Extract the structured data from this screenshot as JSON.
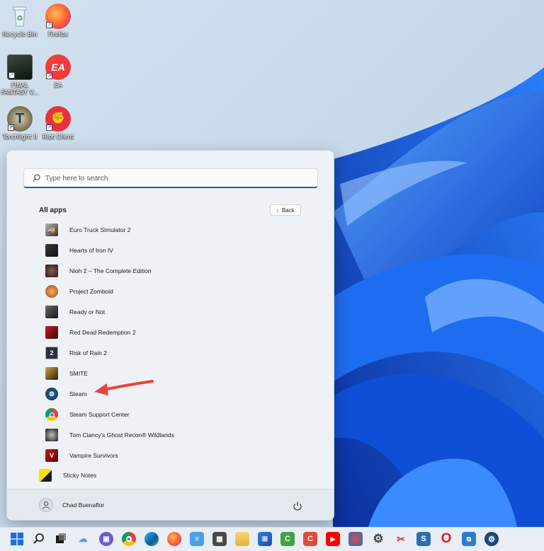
{
  "desktop": {
    "icons": [
      {
        "label": "Recycle Bin",
        "icon": "recycle-bin-icon"
      },
      {
        "label": "Firefox",
        "icon": "firefox-icon"
      },
      {
        "label": "FINAL FANTASY V...",
        "icon": "final-fantasy-icon"
      },
      {
        "label": "EA",
        "icon": "ea-icon"
      },
      {
        "label": "Torchlight II",
        "icon": "torchlight-icon"
      },
      {
        "label": "Riot Client",
        "icon": "riot-client-icon"
      }
    ]
  },
  "start_menu": {
    "search_placeholder": "Type here to search",
    "all_apps_label": "All apps",
    "back_label": "Back",
    "apps": [
      {
        "label": "Euro Truck Simulator 2",
        "icon": "euro-truck-icon"
      },
      {
        "label": "Hearts of Iron IV",
        "icon": "hearts-of-iron-icon"
      },
      {
        "label": "Nioh 2 – The Complete Edition",
        "icon": "nioh-icon"
      },
      {
        "label": "Project Zomboid",
        "icon": "project-zomboid-icon"
      },
      {
        "label": "Ready or Not",
        "icon": "ready-or-not-icon"
      },
      {
        "label": "Red Dead Redemption 2",
        "icon": "red-dead-icon"
      },
      {
        "label": "Risk of Rain 2",
        "icon": "risk-of-rain-icon"
      },
      {
        "label": "SMITE",
        "icon": "smite-icon"
      },
      {
        "label": "Steam",
        "icon": "steam-icon"
      },
      {
        "label": "Steam Support Center",
        "icon": "chrome-icon"
      },
      {
        "label": "Tom Clancy's Ghost Recon® Wildlands",
        "icon": "ghost-recon-icon"
      },
      {
        "label": "Vampire Survivors",
        "icon": "vampire-survivors-icon"
      },
      {
        "label": "Sticky Notes",
        "icon": "sticky-notes-icon"
      }
    ],
    "user_name": "Chad Buenaflor"
  },
  "taskbar": {
    "items": [
      "windows-start-icon",
      "search-icon",
      "task-view-icon",
      "widgets-icon",
      "chat-icon",
      "chrome-icon",
      "edge-icon",
      "firefox-icon",
      "notepad-icon",
      "calculator-icon",
      "file-explorer-icon",
      "store-icon",
      "camtasia-icon",
      "camtasia-recorder-icon",
      "youtube-icon",
      "davinci-icon",
      "settings-icon",
      "snipping-tool-icon",
      "scrivener-icon",
      "opera-icon",
      "remote-desktop-icon",
      "steam-icon"
    ]
  },
  "colors": {
    "accent": "#1f5fa8",
    "wallpaper_bloom": "#1c6ef2",
    "arrow": "#e8453c"
  }
}
